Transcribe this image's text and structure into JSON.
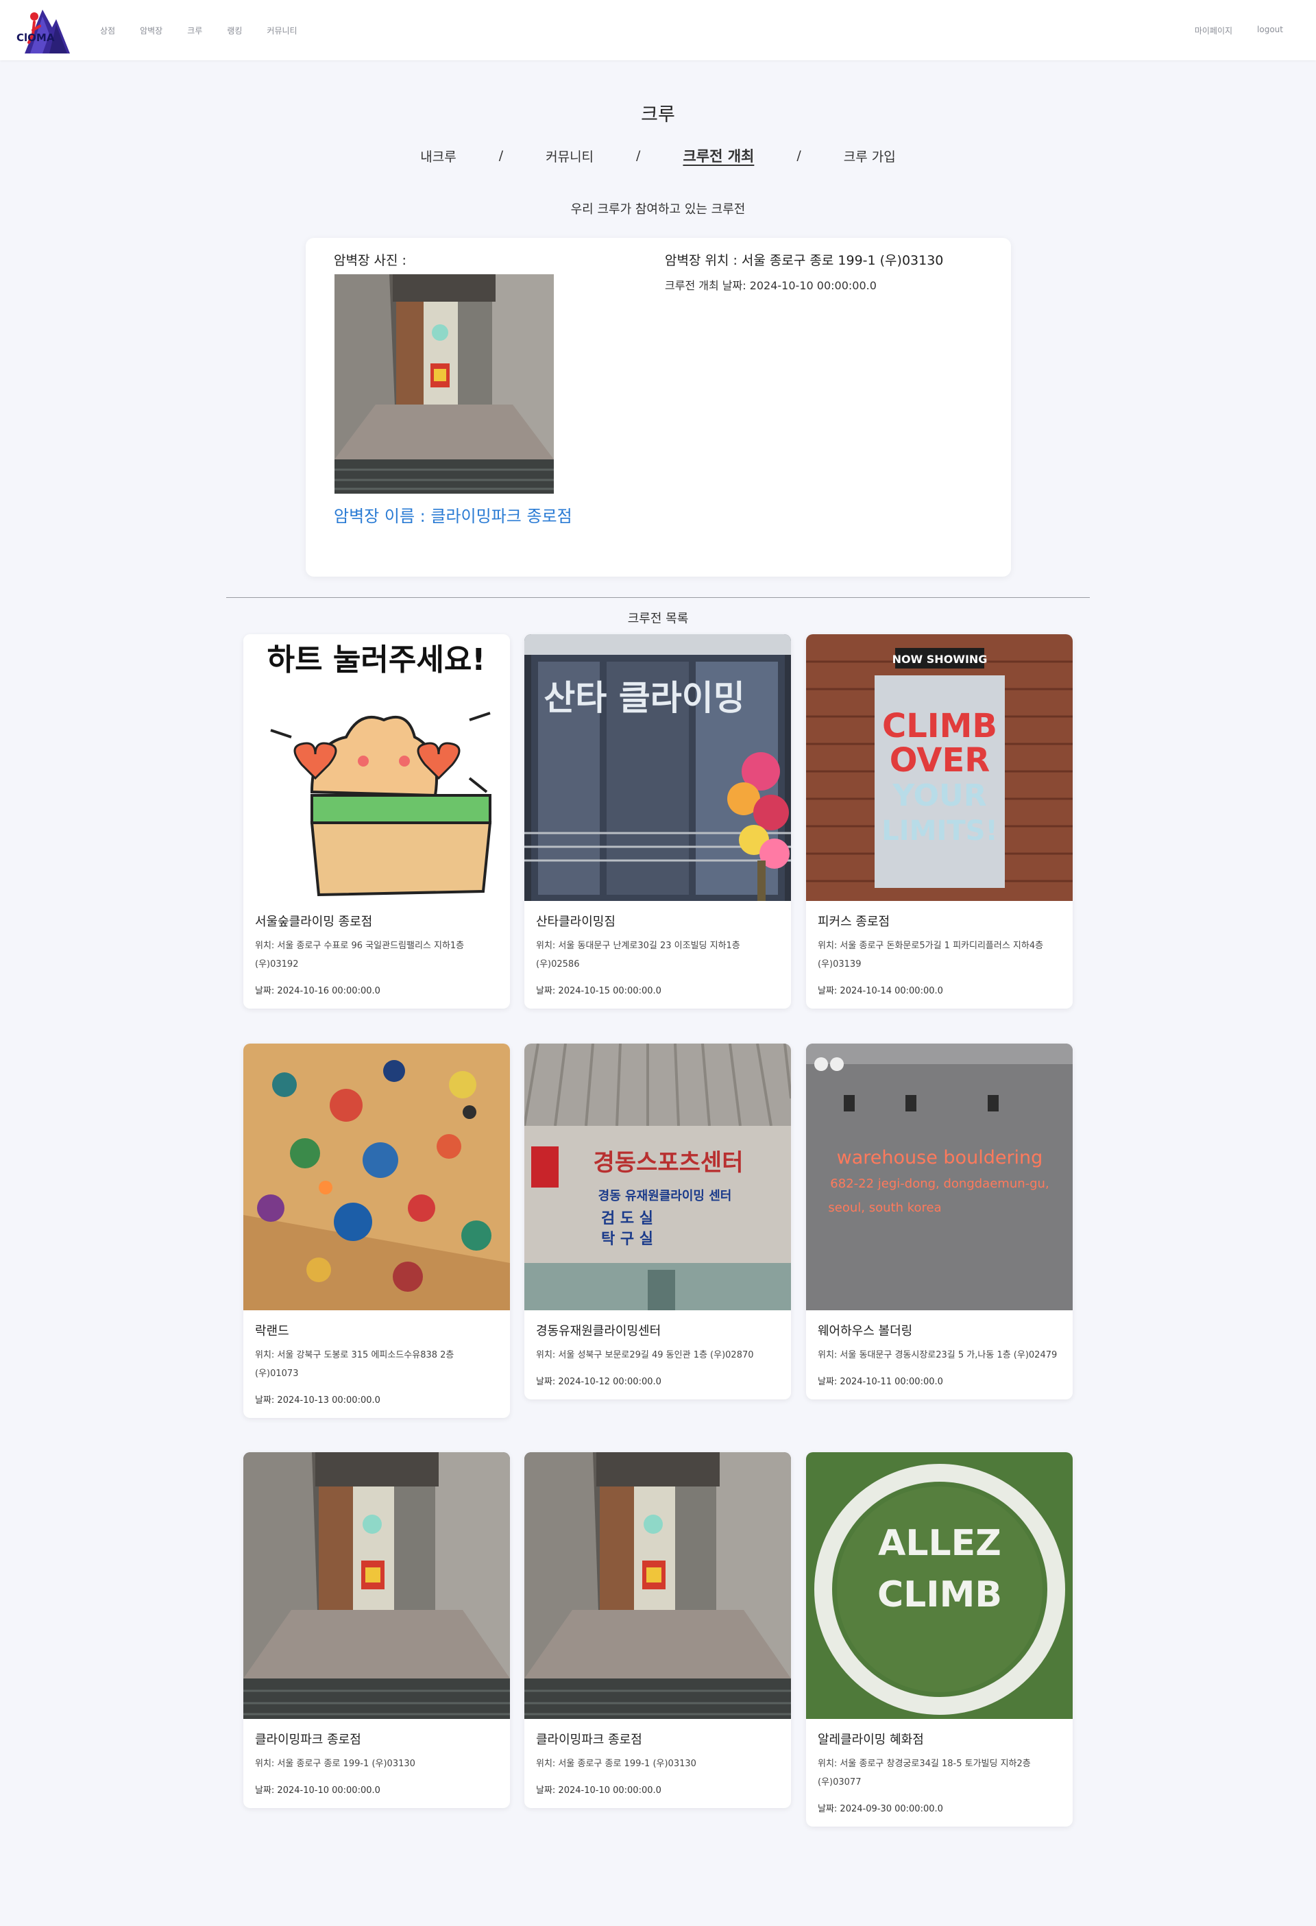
{
  "header": {
    "logo_text": "ClOMA",
    "nav_left": [
      "상점",
      "암벽장",
      "크루",
      "랭킹",
      "커뮤니티"
    ],
    "nav_right": [
      "마이페이지",
      "logout"
    ]
  },
  "page": {
    "title": "크루",
    "tabs": [
      {
        "label": "내크루",
        "active": false
      },
      {
        "label": "커뮤니티",
        "active": false
      },
      {
        "label": "크루전 개최",
        "active": true
      },
      {
        "label": "크루 가입",
        "active": false
      }
    ],
    "tab_separator": "/",
    "section_subtitle": "우리 크루가 참여하고 있는 크루전"
  },
  "featured": {
    "photo_label": "암벽장 사진 :",
    "gym_name": "암벽장 이름 : 클라이밍파크 종로점",
    "location": "암벽장 위치 : 서울 종로구 종로 199-1 (우)03130",
    "date": "크루전 개최 날짜: 2024-10-10 00:00:00.0"
  },
  "list": {
    "title": "크루전 목록",
    "cards": [
      {
        "name": "서울숲클라이밍 종로점",
        "address": "위치: 서울 종로구 수표로 96 국일관드림팰리스 지하1층 (우)03192",
        "date": "날짜: 2024-10-16 00:00:00.0",
        "image": "heart-sticker"
      },
      {
        "name": "산타클라이밍짐",
        "address": "위치: 서울 동대문구 난계로30길 23 이조빌딩 지하1층 (우)02586",
        "date": "날짜: 2024-10-15 00:00:00.0",
        "image": "santa-storefront"
      },
      {
        "name": "피커스 종로점",
        "address": "위치: 서울 종로구 돈화문로5가길 1 피카디리플러스 지하4층 (우)03139",
        "date": "날짜: 2024-10-14 00:00:00.0",
        "image": "climb-poster"
      },
      {
        "name": "락랜드",
        "address": "위치: 서울 강북구 도봉로 315 에피소드수유838 2층 (우)01073",
        "date": "날짜: 2024-10-13 00:00:00.0",
        "image": "holds-wall"
      },
      {
        "name": "경동유재원클라이밍센터",
        "address": "위치: 서울 성북구 보문로29길 49 동인관 1층 (우)02870",
        "date": "날짜: 2024-10-12 00:00:00.0",
        "image": "sports-center-sign"
      },
      {
        "name": "웨어하우스 볼더링",
        "address": "위치: 서울 동대문구 경동시장로23길 5 가,나동 1층 (우)02479",
        "date": "날짜: 2024-10-11 00:00:00.0",
        "image": "neon-sign"
      },
      {
        "name": "클라이밍파크 종로점",
        "address": "위치: 서울 종로구 종로 199-1 (우)03130",
        "date": "날짜: 2024-10-10 00:00:00.0",
        "image": "entrance-stairs"
      },
      {
        "name": "클라이밍파크 종로점",
        "address": "위치: 서울 종로구 종로 199-1 (우)03130",
        "date": "날짜: 2024-10-10 00:00:00.0",
        "image": "entrance-stairs"
      },
      {
        "name": "알레클라이밍 혜화점",
        "address": "위치: 서울 종로구 창경궁로34길 18-5 토가빌딩 지하2층 (우)03077",
        "date": "날짜: 2024-09-30 00:00:00.0",
        "image": "allez-turf"
      }
    ]
  },
  "image_text": {
    "heart_sticker": "하트 눌러주세요!",
    "santa_sign": "산타 클라이밍",
    "poster_head": "NOW SHOWING",
    "poster_line1": "CLIMB",
    "poster_line2": "OVER",
    "poster_line3": "YOUR",
    "poster_line4": "LIMITS!",
    "center_sign1": "경동스포츠센터",
    "center_sign2": "경동 유재원클라이밍 센터",
    "center_sign3": "검 도 실",
    "center_sign4": "탁 구 실",
    "neon1": "warehouse bouldering",
    "neon2": "682-22 jegi-dong, dongdaemun-gu,",
    "neon3": "seoul, south korea",
    "allez1": "ALLEZ",
    "allez2": "CLIMB"
  },
  "colors": {
    "accent_link": "#2a7bd4",
    "background": "#f5f6fb",
    "logo_purple": "#3b2a9a"
  }
}
